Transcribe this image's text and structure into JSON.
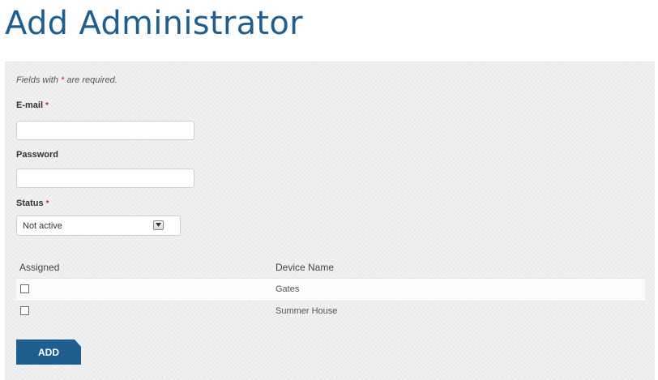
{
  "page": {
    "title": "Add Administrator"
  },
  "form": {
    "note_prefix": "Fields with ",
    "note_star": "*",
    "note_suffix": " are required.",
    "email": {
      "label": "E-mail",
      "required_mark": "*",
      "value": ""
    },
    "password": {
      "label": "Password",
      "value": ""
    },
    "status": {
      "label": "Status",
      "required_mark": "*",
      "selected": "Not active"
    }
  },
  "devices_table": {
    "columns": [
      "Assigned",
      "Device Name"
    ],
    "rows": [
      {
        "assigned": false,
        "device_name": "Gates"
      },
      {
        "assigned": false,
        "device_name": "Summer House"
      }
    ]
  },
  "actions": {
    "add_label": "ADD"
  },
  "colors": {
    "accent": "#1f5f8f",
    "required": "#d21f1f"
  }
}
